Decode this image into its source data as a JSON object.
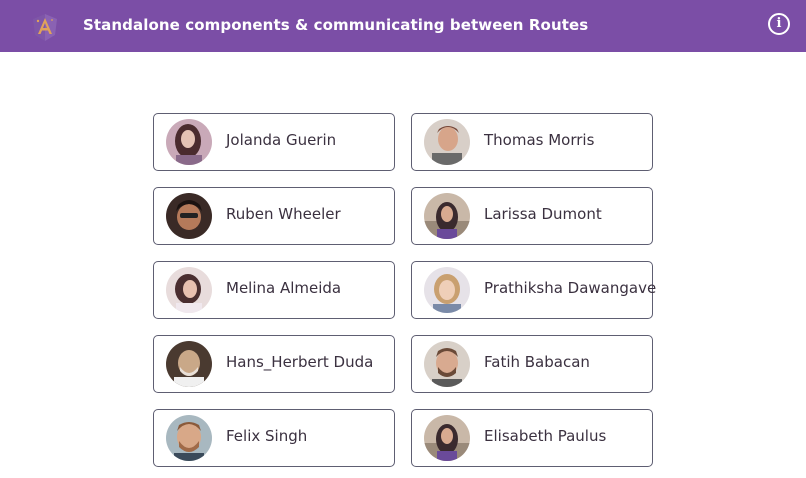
{
  "header": {
    "title": "Standalone components & communicating between Routes",
    "brand_color": "#7b4ea6",
    "info_icon": "info-icon"
  },
  "people": [
    {
      "name": "Jolanda Guerin",
      "avatar_bg": "#c9a9b8",
      "avatar_fg": "#4a2b2e"
    },
    {
      "name": "Thomas Morris",
      "avatar_bg": "#d8cfc8",
      "avatar_fg": "#7a4a3a"
    },
    {
      "name": "Ruben Wheeler",
      "avatar_bg": "#3a2a26",
      "avatar_fg": "#b57a5a"
    },
    {
      "name": "Larissa Dumont",
      "avatar_bg": "#c9b8a8",
      "avatar_fg": "#3a2a2e"
    },
    {
      "name": "Melina Almeida",
      "avatar_bg": "#e8dcdc",
      "avatar_fg": "#4a2e30"
    },
    {
      "name": "Prathiksha Dawangave",
      "avatar_bg": "#e6e2e8",
      "avatar_fg": "#c9a070"
    },
    {
      "name": "Hans_Herbert Duda",
      "avatar_bg": "#4a3a30",
      "avatar_fg": "#c9a888"
    },
    {
      "name": "Fatih Babacan",
      "avatar_bg": "#d8d0c8",
      "avatar_fg": "#6a4a38"
    },
    {
      "name": "Felix Singh",
      "avatar_bg": "#a8b8c0",
      "avatar_fg": "#d8a888"
    },
    {
      "name": "Elisabeth Paulus",
      "avatar_bg": "#c9b8a8",
      "avatar_fg": "#3a2a2e"
    }
  ]
}
